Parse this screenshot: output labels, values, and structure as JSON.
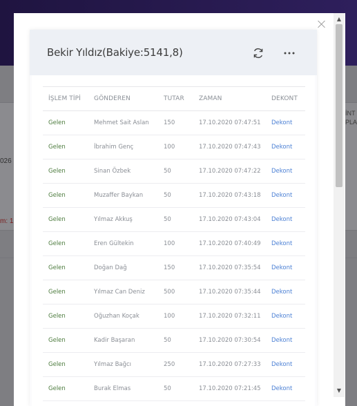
{
  "background": {
    "header_right_line1": "İNT",
    "header_right_line2": "PLA",
    "left_number_fragment": "026",
    "left_red_fragment": "m: 1"
  },
  "card": {
    "title": "Bekir Yıldız(Bakiye:5141,8)",
    "refresh_icon": "refresh-icon",
    "more_icon": "more-horizontal-icon"
  },
  "table": {
    "headers": [
      "İŞLEM TİPİ",
      "GÖNDEREN",
      "TUTAR",
      "ZAMAN",
      "DEKONT"
    ],
    "rows": [
      {
        "type": "Gelen",
        "sender": "Mehmet Sait Aslan",
        "amount": "150",
        "time": "17.10.2020 07:47:51",
        "receipt": "Dekont"
      },
      {
        "type": "Gelen",
        "sender": "İbrahim Genç",
        "amount": "100",
        "time": "17.10.2020 07:47:43",
        "receipt": "Dekont"
      },
      {
        "type": "Gelen",
        "sender": "Sinan Özbek",
        "amount": "50",
        "time": "17.10.2020 07:47:22",
        "receipt": "Dekont"
      },
      {
        "type": "Gelen",
        "sender": "Muzaffer Baykan",
        "amount": "50",
        "time": "17.10.2020 07:43:18",
        "receipt": "Dekont"
      },
      {
        "type": "Gelen",
        "sender": "Yılmaz Akkuş",
        "amount": "50",
        "time": "17.10.2020 07:43:04",
        "receipt": "Dekont"
      },
      {
        "type": "Gelen",
        "sender": "Eren Gültekin",
        "amount": "100",
        "time": "17.10.2020 07:40:49",
        "receipt": "Dekont"
      },
      {
        "type": "Gelen",
        "sender": "Doğan Dağ",
        "amount": "150",
        "time": "17.10.2020 07:35:54",
        "receipt": "Dekont"
      },
      {
        "type": "Gelen",
        "sender": "Yılmaz Can Deniz",
        "amount": "500",
        "time": "17.10.2020 07:35:44",
        "receipt": "Dekont"
      },
      {
        "type": "Gelen",
        "sender": "Oğuzhan Koçak",
        "amount": "100",
        "time": "17.10.2020 07:32:11",
        "receipt": "Dekont"
      },
      {
        "type": "Gelen",
        "sender": "Kadir Başaran",
        "amount": "50",
        "time": "17.10.2020 07:30:54",
        "receipt": "Dekont"
      },
      {
        "type": "Gelen",
        "sender": "Yılmaz Bağcı",
        "amount": "250",
        "time": "17.10.2020 07:27:33",
        "receipt": "Dekont"
      },
      {
        "type": "Gelen",
        "sender": "Burak Elmas",
        "amount": "50",
        "time": "17.10.2020 07:21:45",
        "receipt": "Dekont"
      }
    ]
  },
  "colors": {
    "type_text": "#4b7a3c",
    "receipt_link": "#4a7fd4",
    "header_bg": "#edf0f5"
  }
}
